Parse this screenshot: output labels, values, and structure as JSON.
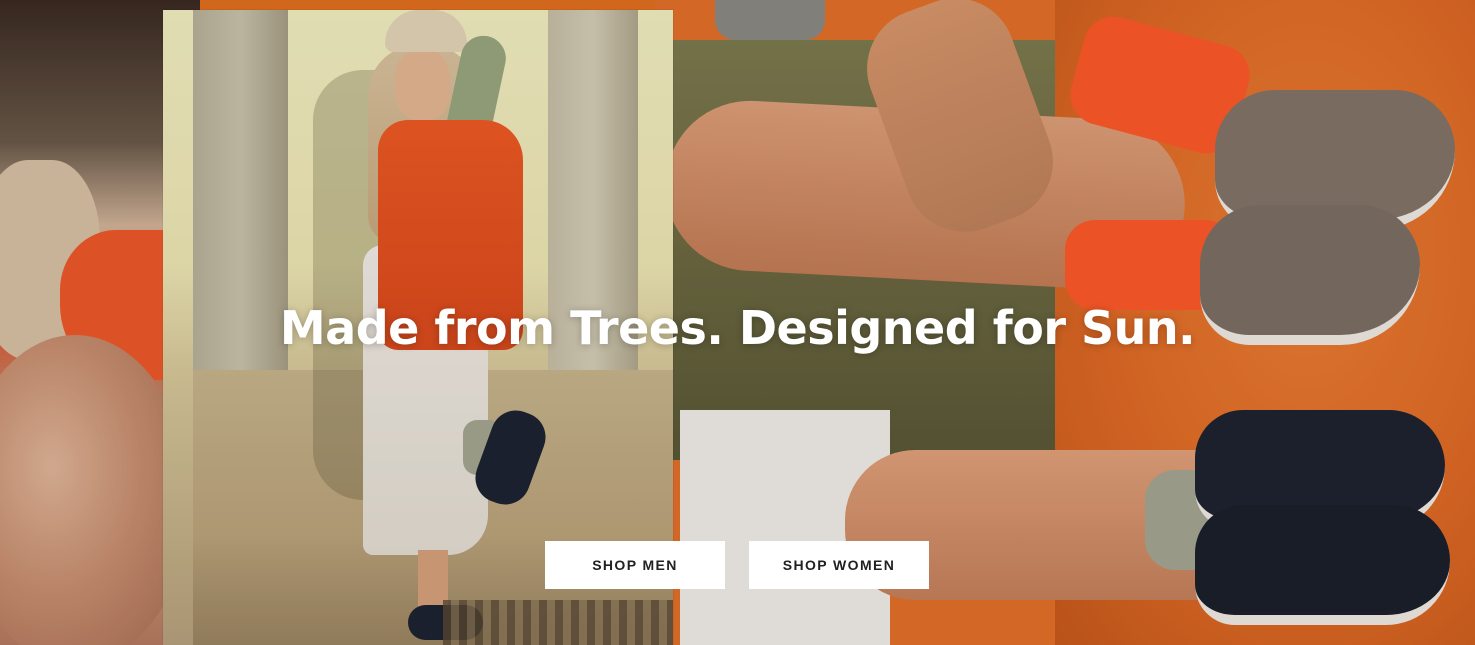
{
  "hero": {
    "headline": "Made from Trees. Designed for Sun.",
    "buttons": {
      "shop_men": "SHOP MEN",
      "shop_women": "SHOP WOMEN"
    },
    "colors": {
      "button_bg": "#ffffff",
      "button_text": "#212121",
      "headline_text": "#ffffff",
      "accent_orange": "#e4702a"
    }
  }
}
